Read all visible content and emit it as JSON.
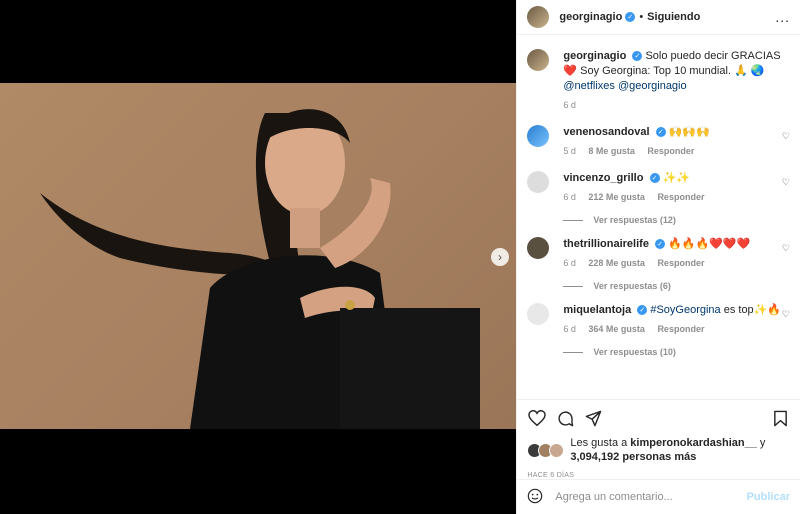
{
  "header": {
    "username": "georginagio",
    "separator": "•",
    "follow_label": "Siguiendo",
    "more_label": "..."
  },
  "caption": {
    "username": "georginagio",
    "text": "Solo puedo decir GRACIAS ❤️ Soy Georgina: Top 10 mundial. 🙏 🌏",
    "mention1": "@netflixes",
    "mention2": "@georginagio",
    "time": "6 d"
  },
  "comments": [
    {
      "username": "venenosandoval",
      "text": "🙌🙌🙌",
      "time": "5 d",
      "likes": "8 Me gusta",
      "reply": "Responder",
      "replies": ""
    },
    {
      "username": "vincenzo_grillo",
      "text": "✨✨",
      "time": "6 d",
      "likes": "212 Me gusta",
      "reply": "Responder",
      "replies": "Ver respuestas (12)"
    },
    {
      "username": "thetrillionairelife",
      "text": "🔥🔥🔥❤️❤️❤️",
      "time": "6 d",
      "likes": "228 Me gusta",
      "reply": "Responder",
      "replies": "Ver respuestas (6)"
    },
    {
      "username": "miquelantoja",
      "hashtag": "#SoyGeorgina",
      "text": " es top✨🔥",
      "time": "6 d",
      "likes": "364 Me gusta",
      "reply": "Responder",
      "replies": "Ver respuestas (10)"
    }
  ],
  "likes": {
    "prefix": "Les gusta a ",
    "user": "kimperonokardashian__",
    "middle": " y",
    "count": "3,094,192 personas más"
  },
  "date": "HACE 6 DÍAS",
  "composer": {
    "placeholder": "Agrega un comentario...",
    "publish": "Publicar"
  },
  "carousel": {
    "total": 4,
    "active": 0
  },
  "colors": {
    "accent": "#3897f0",
    "link": "#00376b",
    "muted": "#8e8e8e",
    "publish_disabled": "#b2dffc"
  }
}
